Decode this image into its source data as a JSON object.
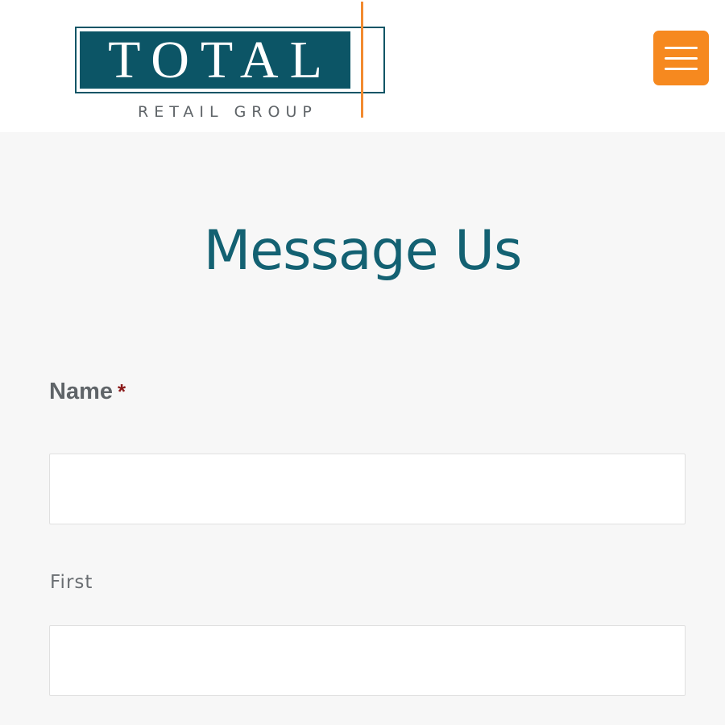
{
  "header": {
    "logo": {
      "word": "TOTAL",
      "subtitle": "RETAIL GROUP"
    },
    "menu_icon": "hamburger-menu-icon"
  },
  "main": {
    "title": "Message Us",
    "form": {
      "name_field": {
        "label": "Name",
        "required_mark": "*",
        "first_value": "",
        "first_sublabel": "First",
        "second_value": ""
      }
    }
  },
  "colors": {
    "brand_teal": "#0c5566",
    "title_teal": "#136172",
    "accent_orange": "#f6891f",
    "required_red": "#8b1a1a",
    "background": "#f7f7f7"
  }
}
